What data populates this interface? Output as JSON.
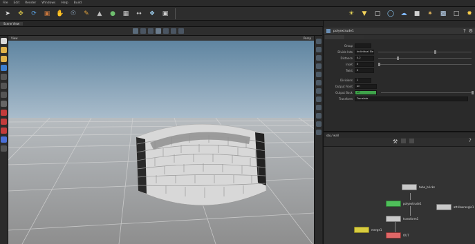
{
  "colors": {
    "accent_blue": "#3c7fd1",
    "green_flag": "#4fbf5a",
    "bypass_yellow": "#d9cd3f",
    "display_blue": "#4a6fd8",
    "wall_light": "#d8d8d8",
    "ground": "#9b9b9b",
    "sky": "#6d8fa7"
  },
  "menubar": {
    "items": [
      "File",
      "Edit",
      "Render",
      "Windows",
      "Help",
      "Build"
    ]
  },
  "shelf": {
    "left_tools": [
      "select-icon",
      "move-icon",
      "rotate-icon",
      "scale-icon",
      "handle-icon",
      "pose-icon",
      "brush-icon",
      "sculpt-icon",
      "paint-icon",
      "group-icon",
      "measure-icon",
      "snap-icon",
      "camera-icon"
    ],
    "right_tools": [
      "light-icon",
      "spotlight-icon",
      "area-light-icon",
      "env-light-icon",
      "sky-icon",
      "camera-rig-icon",
      "gi-icon",
      "volume-icon",
      "portal-icon",
      "sun-icon"
    ]
  },
  "viewport": {
    "tab_label": "Scene View",
    "nav_label": "View",
    "nav_right": "Persp"
  },
  "params": {
    "node_label": "polyextrude1",
    "rows": [
      {
        "label": "Group",
        "value": ""
      },
      {
        "label": "Divide Into",
        "value": "Individual Elements"
      },
      {
        "label": "Distance",
        "value": "0.2"
      },
      {
        "label": "Inset",
        "value": "0"
      },
      {
        "label": "Twist",
        "value": "0"
      },
      {
        "label": "Divisions",
        "value": "1"
      },
      {
        "label": "Output Front",
        "value": "on"
      },
      {
        "label": "Output Back",
        "value": "off"
      },
      {
        "label": "Transform",
        "value": "Translate"
      }
    ]
  },
  "network": {
    "path_label": "obj / wall",
    "nodes": [
      {
        "name": "tube_bricks"
      },
      {
        "name": "polyextrude1"
      },
      {
        "name": "attribwrangle1"
      },
      {
        "name": "transform1"
      },
      {
        "name": "merge1"
      },
      {
        "name": "OUT"
      }
    ]
  }
}
